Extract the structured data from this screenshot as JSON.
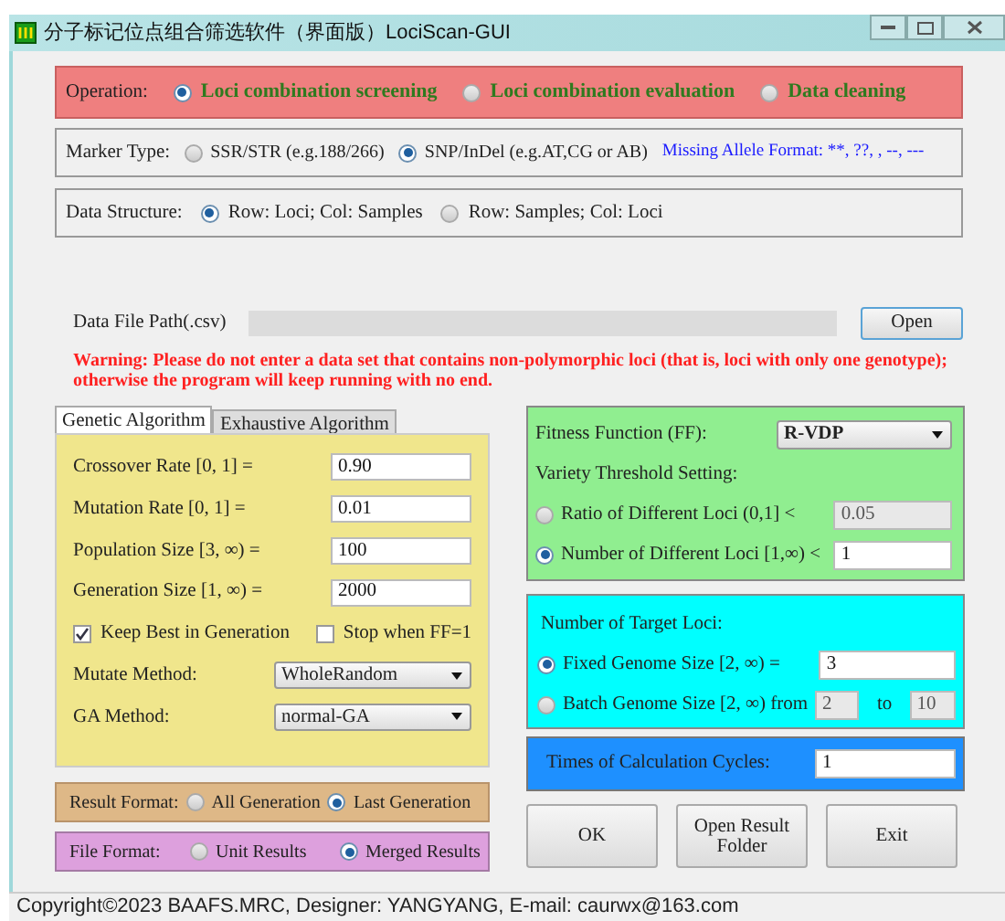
{
  "window": {
    "title": "分子标记位点组合筛选软件（界面版）LociScan-GUI"
  },
  "operation": {
    "label": "Operation:",
    "options": [
      {
        "label": "Loci combination screening",
        "selected": true
      },
      {
        "label": "Loci combination evaluation",
        "selected": false
      },
      {
        "label": "Data cleaning",
        "selected": false
      }
    ]
  },
  "marker_type": {
    "label": "Marker Type:",
    "options": [
      {
        "label": "SSR/STR (e.g.188/266)",
        "selected": false
      },
      {
        "label": "SNP/InDel (e.g.AT,CG or AB)",
        "selected": true
      }
    ],
    "note": "Missing Allele Format: **, ??, , --, ---"
  },
  "data_structure": {
    "label": "Data Structure:",
    "options": [
      {
        "label": "Row: Loci; Col: Samples",
        "selected": true
      },
      {
        "label": "Row: Samples; Col: Loci",
        "selected": false
      }
    ]
  },
  "data_file": {
    "label": "Data File Path(.csv)",
    "button": "Open"
  },
  "warning": "Warning: Please do not enter a data set that contains non-polymorphic loci (that is, loci with only one genotype); otherwise the program will keep running with no end.",
  "tabs": [
    {
      "label": "Genetic Algorithm",
      "selected": true
    },
    {
      "label": "Exhaustive Algorithm",
      "selected": false
    }
  ],
  "ga_params": [
    {
      "label": "Crossover Rate [0, 1] =",
      "value": "0.90"
    },
    {
      "label": "Mutation Rate [0, 1] =",
      "value": "0.01"
    },
    {
      "label": "Population Size [3, ∞) =",
      "value": "100"
    },
    {
      "label": "Generation Size [1, ∞) =",
      "value": "2000"
    }
  ],
  "ga_checks": [
    {
      "label": "Keep Best in Generation",
      "checked": true
    },
    {
      "label": "Stop when FF=1",
      "checked": false
    }
  ],
  "ga_selects": [
    {
      "label": "Mutate Method:",
      "value": "WholeRandom"
    },
    {
      "label": "GA Method:",
      "value": "normal-GA"
    }
  ],
  "fitness": {
    "label": "Fitness Function (FF):",
    "value": "R-VDP",
    "threshold_label": "Variety Threshold Setting:",
    "options": [
      {
        "label": "Ratio of Different Loci (0,1] <",
        "value": "0.05",
        "selected": false
      },
      {
        "label": "Number of Different Loci [1,∞) <",
        "value": "1",
        "selected": true
      }
    ]
  },
  "target_loci": {
    "label": "Number of Target Loci:",
    "options": [
      {
        "label": "Fixed Genome Size [2, ∞) =",
        "value": "3",
        "selected": true
      },
      {
        "label": "Batch Genome Size [2, ∞) from",
        "value": "2",
        "to_label": "to",
        "to_value": "10",
        "selected": false
      }
    ]
  },
  "cycles": {
    "label": "Times of Calculation Cycles:",
    "value": "1"
  },
  "result_format": {
    "label": "Result Format:",
    "options": [
      {
        "label": "All Generation",
        "selected": false
      },
      {
        "label": "Last Generation",
        "selected": true
      }
    ]
  },
  "file_format": {
    "label": "File Format:",
    "options": [
      {
        "label": "Unit Results",
        "selected": false
      },
      {
        "label": "Merged Results",
        "selected": true
      }
    ]
  },
  "buttons": [
    "OK",
    "Open Result Folder",
    "Exit"
  ],
  "status_bar": "Copyright©2023 BAAFS.MRC,  Designer: YANGYANG,  E-mail: caurwx@163.com"
}
